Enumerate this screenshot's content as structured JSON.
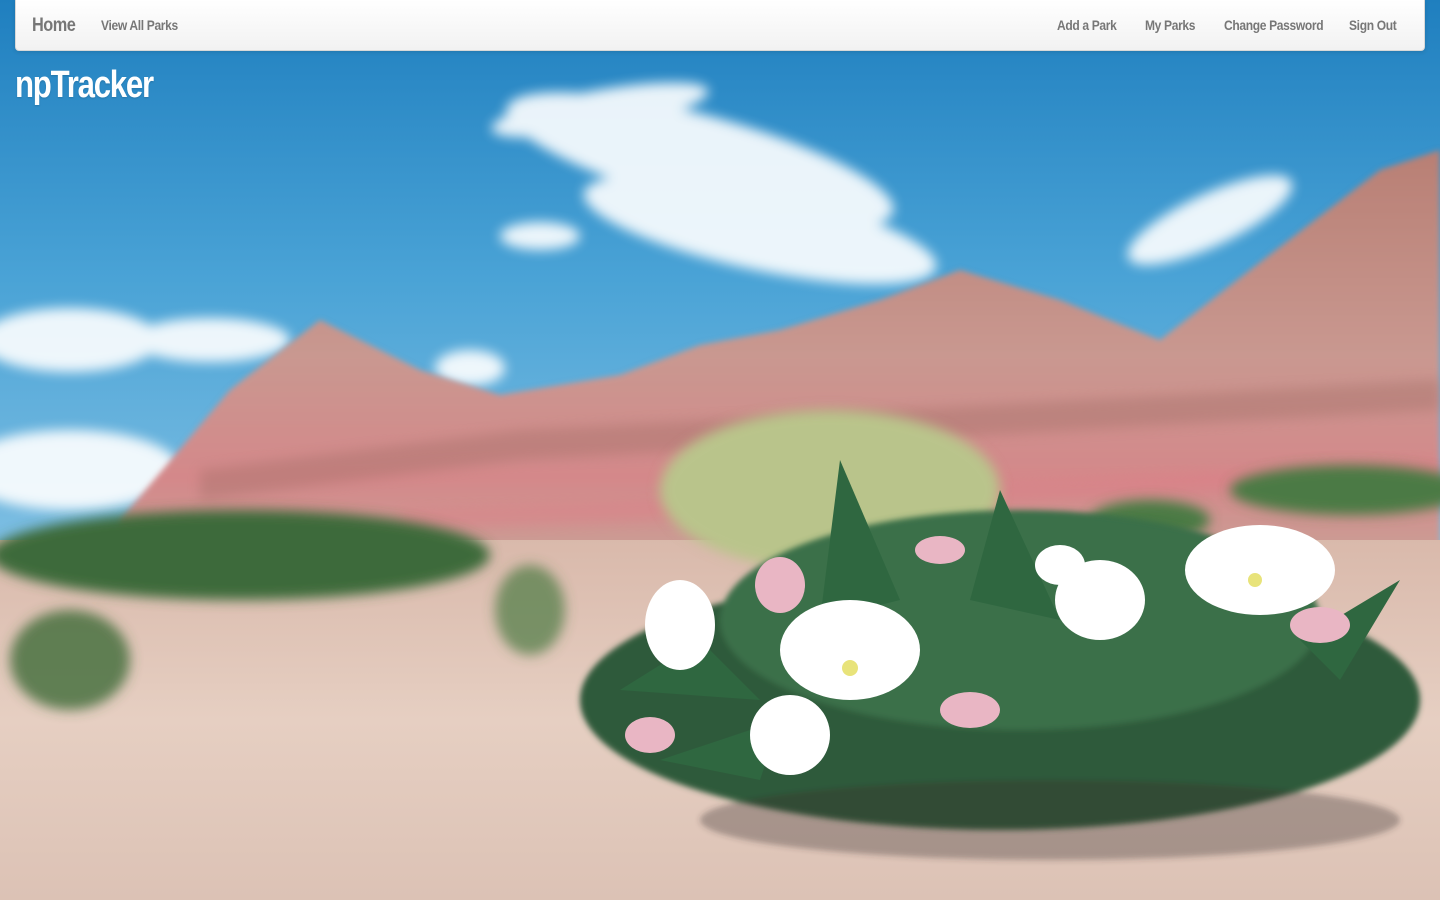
{
  "navbar": {
    "brand": "Home",
    "left_links": [
      "View All Parks"
    ],
    "right_links": [
      "Add a Park",
      "My Parks",
      "Change Password",
      "Sign Out"
    ]
  },
  "header": {
    "title": "npTracker"
  },
  "background": {
    "description_colors": {
      "sky": "#2f8fc6",
      "cliffs": "#c98f86",
      "ground": "#e3cbbd",
      "foliage": "#3f6e45"
    }
  }
}
